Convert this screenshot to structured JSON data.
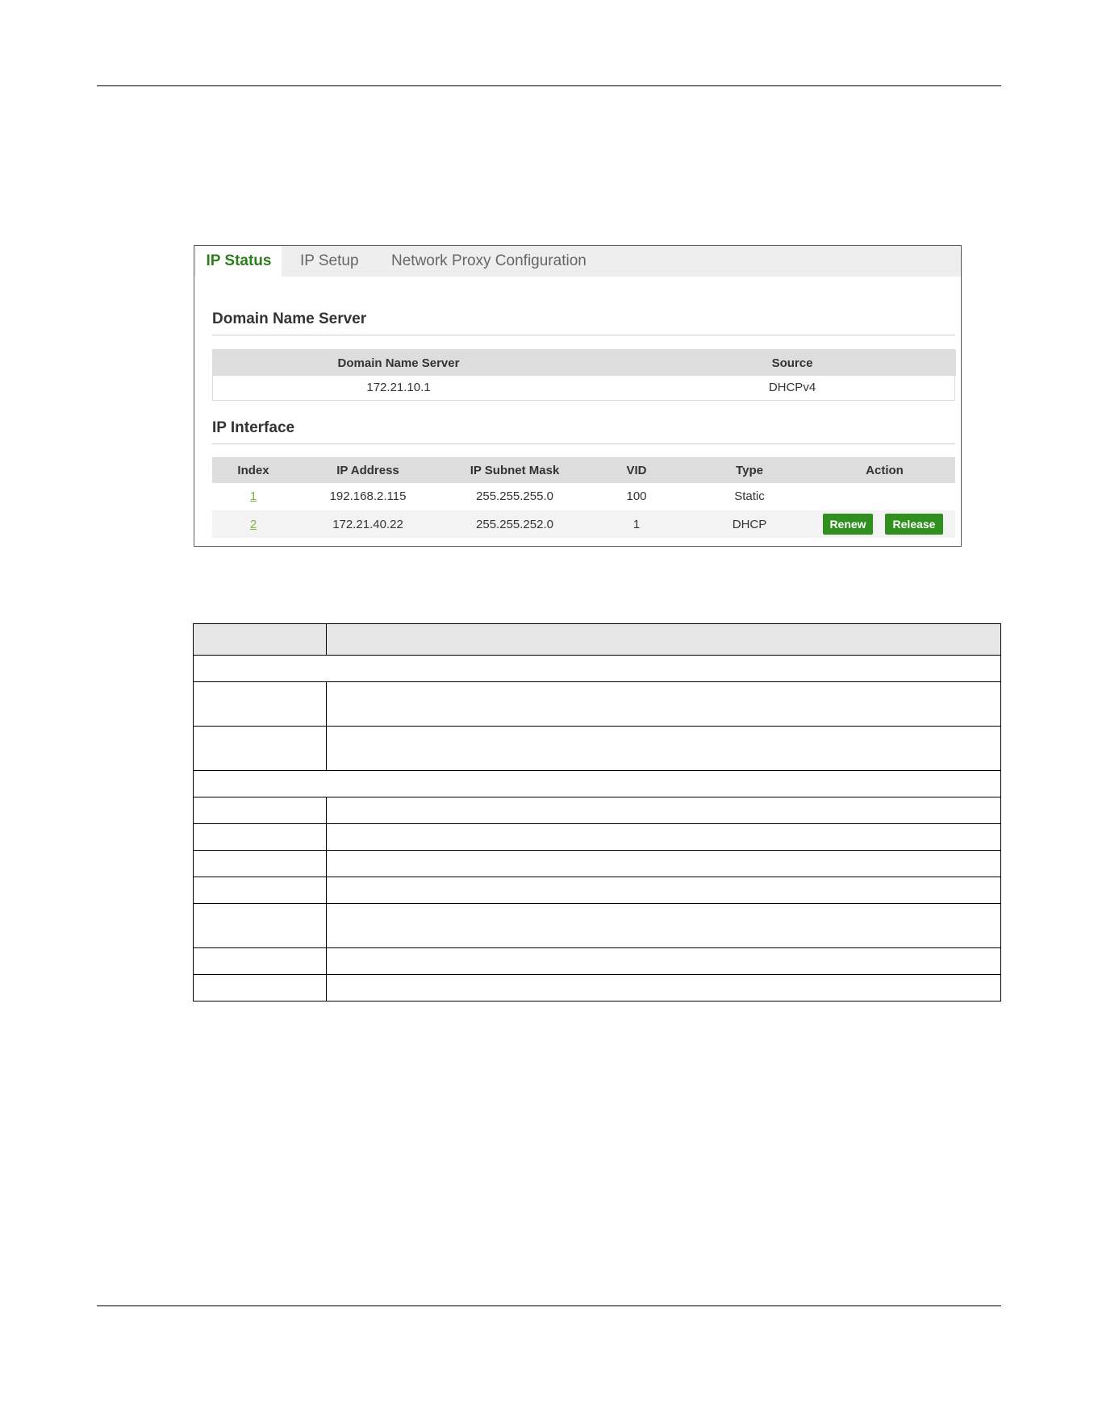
{
  "tabs": [
    {
      "label": "IP Status",
      "active": true
    },
    {
      "label": "IP Setup",
      "active": false
    },
    {
      "label": "Network Proxy Configuration",
      "active": false
    }
  ],
  "dns_section": {
    "title": "Domain Name Server",
    "columns": [
      "Domain Name Server",
      "Source"
    ],
    "rows": [
      {
        "server": "172.21.10.1",
        "source": "DHCPv4"
      }
    ]
  },
  "ip_section": {
    "title": "IP Interface",
    "columns": [
      "Index",
      "IP Address",
      "IP Subnet Mask",
      "VID",
      "Type",
      "Action"
    ],
    "rows": [
      {
        "index": "1",
        "ip": "192.168.2.115",
        "mask": "255.255.255.0",
        "vid": "100",
        "type": "Static"
      },
      {
        "index": "2",
        "ip": "172.21.40.22",
        "mask": "255.255.252.0",
        "vid": "1",
        "type": "DHCP",
        "actions": [
          "Renew",
          "Release"
        ]
      }
    ]
  },
  "colors": {
    "accent_green": "#2e7d1f",
    "button_green": "#2f8f1f",
    "link_green": "#7cb342",
    "tab_bar": "#eeeeee",
    "header_gray": "#dddddd"
  }
}
